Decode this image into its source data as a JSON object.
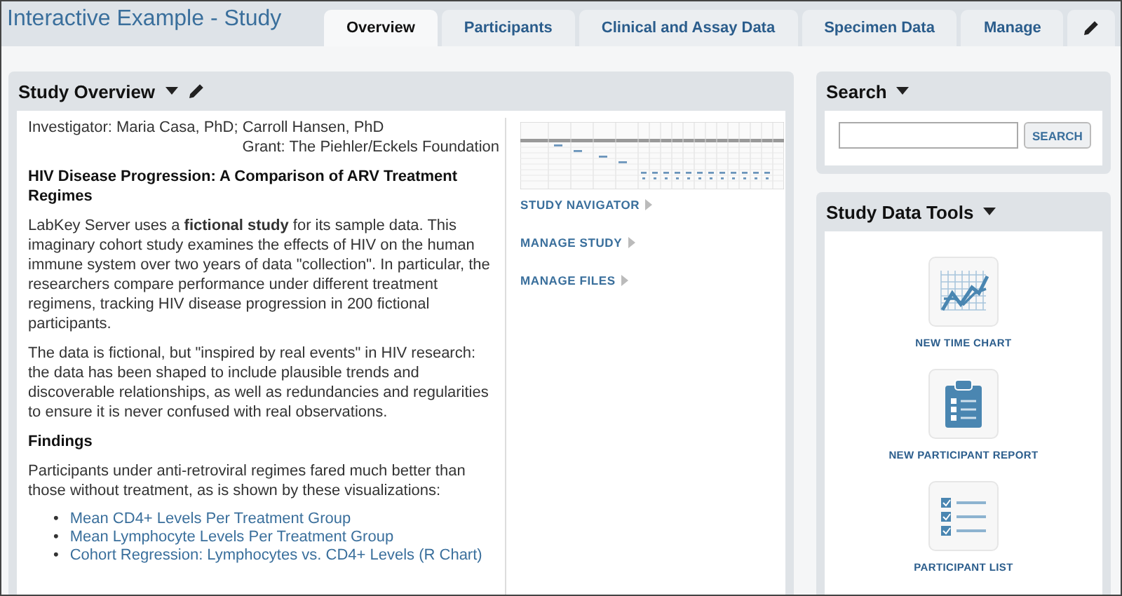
{
  "header": {
    "title": "Interactive Example - Study"
  },
  "tabs": [
    {
      "label": "Overview",
      "selected": true
    },
    {
      "label": "Participants",
      "selected": false
    },
    {
      "label": "Clinical and Assay Data",
      "selected": false
    },
    {
      "label": "Specimen Data",
      "selected": false
    },
    {
      "label": "Manage",
      "selected": false
    }
  ],
  "study_overview": {
    "title": "Study Overview",
    "investigator": "Investigator: Maria Casa, PhD; Carroll Hansen, PhD",
    "grant": "Grant: The Piehler/Eckels Foundation",
    "heading": "HIV Disease Progression: A Comparison of ARV Treatment Regimes",
    "paragraphs": [
      "LabKey Server uses a **fictional study** for its sample data. This imaginary cohort study examines the effects of HIV on the human immune system over two years of data \"collection\". In particular, the researchers compare performance under different treatment regimens, tracking HIV disease progression in 200 fictional participants.",
      "The data is fictional, but \"inspired by real events\" in HIV research: the data has been shaped to include plausible trends and discoverable relationships, as well as redundancies and regularities to ensure it is never confused with real observations."
    ],
    "findings_heading": "Findings",
    "findings_text": "Participants under anti-retroviral regimes fared much better than those without treatment, as is shown by these visualizations:",
    "links": [
      {
        "marker": "•",
        "label": "Mean CD4+ Levels Per Treatment Group"
      },
      {
        "marker": "•",
        "label": "Mean Lymphocyte Levels Per Treatment Group"
      },
      {
        "marker": "•",
        "label": "Cohort Regression: Lymphocytes vs. CD4+ Levels (R Chart)"
      }
    ],
    "nav_links": [
      "STUDY NAVIGATOR",
      "MANAGE STUDY",
      "MANAGE FILES"
    ]
  },
  "search": {
    "title": "Search",
    "button": "SEARCH"
  },
  "study_data_tools": {
    "title": "Study Data Tools",
    "tools": [
      {
        "kind": "time_chart",
        "label": "NEW TIME CHART"
      },
      {
        "kind": "report",
        "label": "NEW PARTICIPANT REPORT"
      },
      {
        "kind": "list",
        "label": "PARTICIPANT LIST"
      }
    ]
  }
}
